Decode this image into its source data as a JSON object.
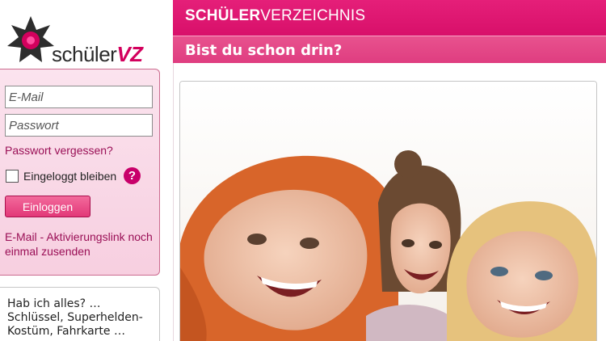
{
  "logo": {
    "text_main": "schüler",
    "text_accent": "VZ",
    "icon": "star-flower-logo"
  },
  "login": {
    "email_placeholder": "E-Mail",
    "password_placeholder": "Passwort",
    "forgot_label": "Passwort vergessen?",
    "remember_label": "Eingeloggt bleiben",
    "help_symbol": "?",
    "submit_label": "Einloggen",
    "activation_label": "E-Mail - Aktivierungslink noch einmal zusenden"
  },
  "note": {
    "text": "Hab ich alles? … Schlüssel, Superhelden-Kostüm, Fahrkarte …"
  },
  "header": {
    "title_bold": "SCHÜLER",
    "title_regular": "VERZEICHNIS",
    "subtitle": "Bist du schon drin?"
  },
  "colors": {
    "brand": "#d8106a",
    "sub_bar": "#e8528e",
    "link": "#9a0f56"
  },
  "icons": [
    "star-flower-logo",
    "help-icon"
  ]
}
